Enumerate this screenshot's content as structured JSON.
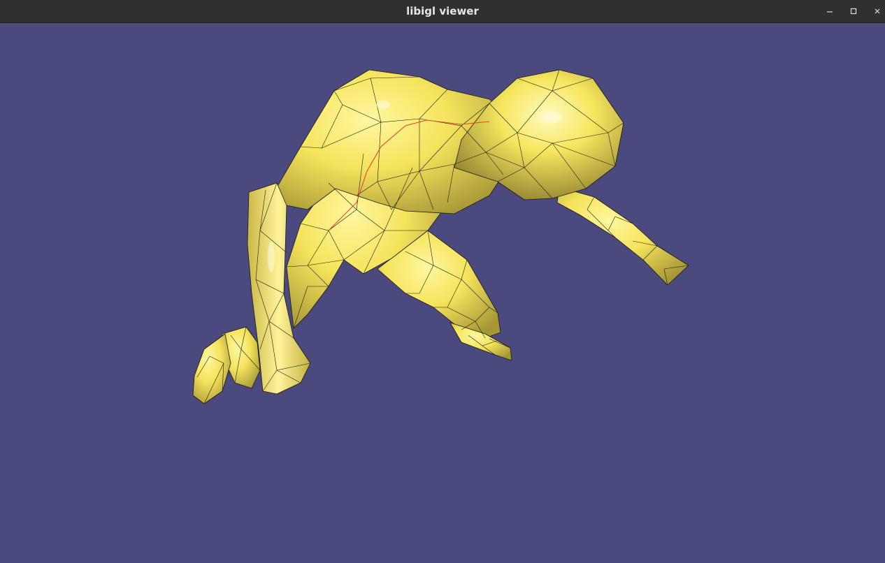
{
  "window": {
    "title": "libigl viewer"
  },
  "viewer": {
    "background_color": "#4b4a7f",
    "mesh_color": "#f3e35a",
    "wire_color": "#1c1a10",
    "highlight_path_color": "#e0482a",
    "icons": {
      "minimize": "minimize-icon",
      "maximize": "maximize-icon",
      "close": "close-icon"
    }
  }
}
